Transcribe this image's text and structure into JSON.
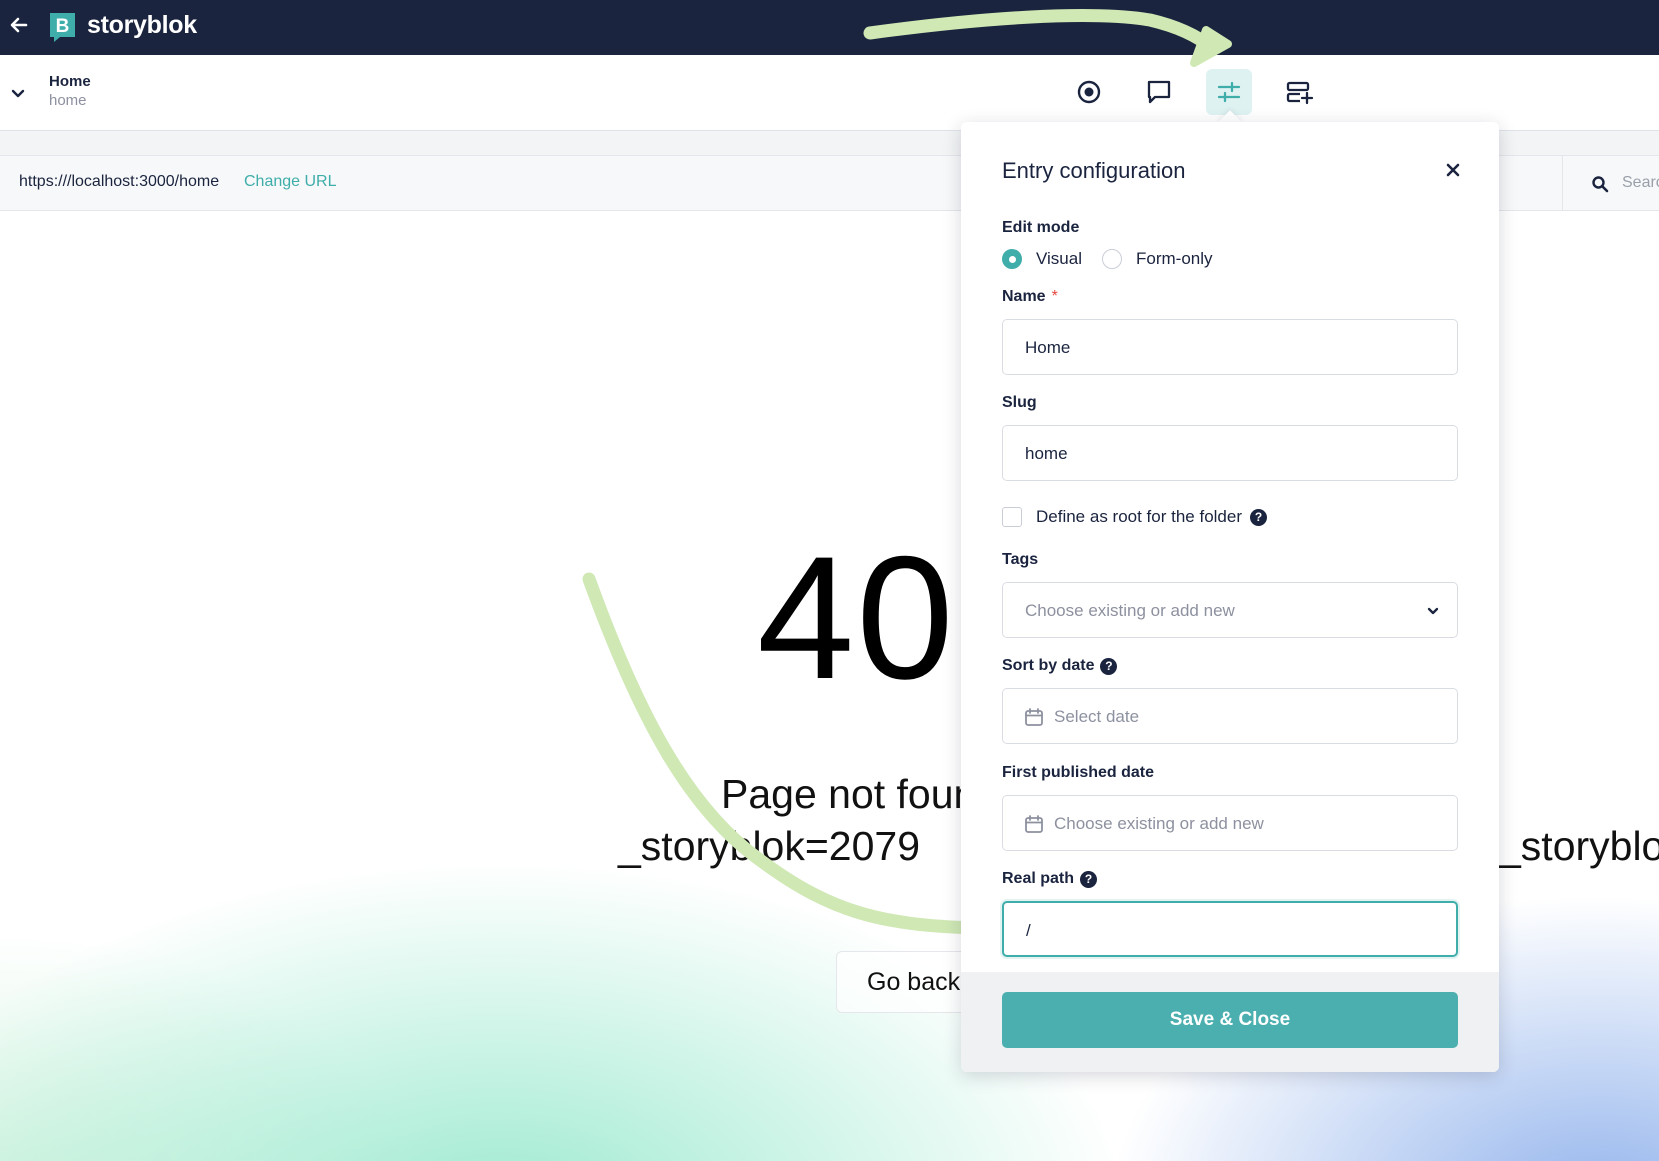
{
  "app": {
    "logo_text": "storyblok"
  },
  "story": {
    "name": "Home",
    "slug": "home"
  },
  "toolbar": {
    "icons": [
      "preview-record-icon",
      "comment-icon",
      "sliders-icon",
      "add-block-icon"
    ],
    "active": "sliders-icon"
  },
  "preview": {
    "url": "https:///localhost:3000/home",
    "change_url_label": "Change URL",
    "search_placeholder": "Searc",
    "big_text": "40",
    "not_found_line1": "Page not foun",
    "not_found_line2": "_storyblok=2079",
    "not_found_line2_tail": "_storyblo",
    "go_back_label": "Go back"
  },
  "entry_config": {
    "title": "Entry configuration",
    "edit_mode_label": "Edit mode",
    "edit_mode_options": [
      "Visual",
      "Form-only"
    ],
    "edit_mode_selected": "Visual",
    "name_label": "Name",
    "name_required_mark": "*",
    "name_value": "Home",
    "slug_label": "Slug",
    "slug_value": "home",
    "root_folder_label": "Define as root for the folder",
    "root_folder_checked": false,
    "tags_label": "Tags",
    "tags_placeholder": "Choose existing or add new",
    "sort_by_date_label": "Sort by date",
    "sort_by_date_placeholder": "Select date",
    "first_published_label": "First published date",
    "first_published_placeholder": "Choose existing or add new",
    "real_path_label": "Real path",
    "real_path_value": "/",
    "help_glyph": "?",
    "save_label": "Save & Close"
  },
  "colors": {
    "topbar": "#1b243f",
    "accent": "#3faeab",
    "save_button": "#4cafaf",
    "annotation_arrow": "#cfe8b4"
  }
}
